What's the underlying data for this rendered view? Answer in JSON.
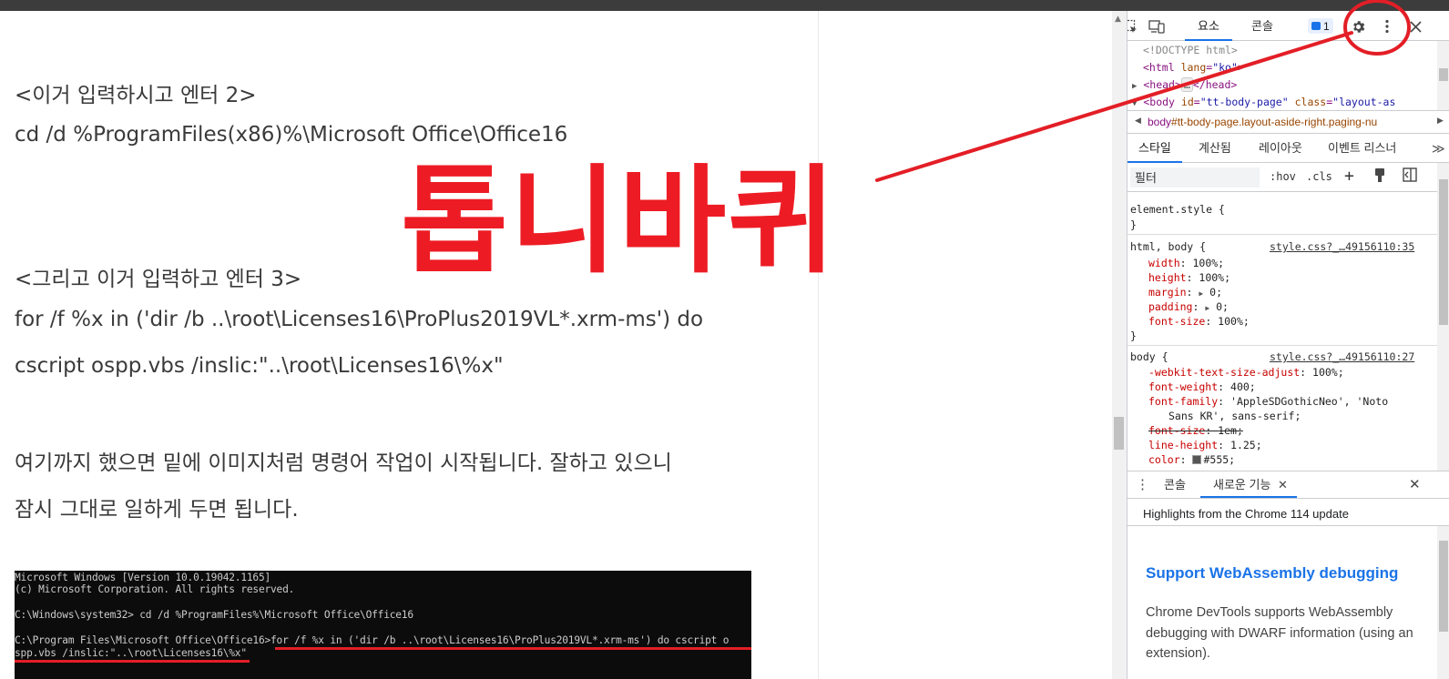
{
  "page": {
    "heading2": "<이거 입력하시고 엔터 2>",
    "cmd2": "cd /d %ProgramFiles(x86)%\\Microsoft Office\\Office16",
    "heading3": "<그리고 이거 입력하고 엔터 3>",
    "cmd3_line1": "for /f %x in ('dir /b ..\\root\\Licenses16\\ProPlus2019VL*.xrm-ms') do",
    "cmd3_line2": "cscript ospp.vbs /inslic:\"..\\root\\Licenses16\\%x\"",
    "info_line1": "여기까지 했으면 밑에 이미지처럼 명령어 작업이 시작됩니다. 잘하고 있으니",
    "info_line2": "잠시 그대로 일하게 두면 됩니다.",
    "overlay_title": "톱니바퀴",
    "terminal": {
      "line1": "Microsoft Windows [Version 10.0.19042.1165]",
      "line2": "(c) Microsoft Corporation. All rights reserved.",
      "line3": "C:\\Windows\\system32> cd /d %ProgramFiles%\\Microsoft Office\\Office16",
      "line4": "C:\\Program Files\\Microsoft Office\\Office16>for /f %x in ('dir /b ..\\root\\Licenses16\\ProPlus2019VL*.xrm-ms') do cscript o",
      "line5": "spp.vbs /inslic:\"..\\root\\Licenses16\\%x\""
    }
  },
  "devtools": {
    "toolbar": {
      "tab_elements": "요소",
      "tab_console": "콘솔",
      "message_count": "1",
      "icons": [
        "inspect-icon",
        "device-toolbar-icon",
        "gear-icon",
        "more-icon",
        "close-icon"
      ]
    },
    "dom": {
      "doctype": "<!DOCTYPE html>",
      "html_open": "<html",
      "html_attr": "lang",
      "html_val": "\"ko\"",
      "html_close": ">",
      "head_open": "<head>",
      "head_ellipsis": "…",
      "head_close": "</head>",
      "body_open": "<body",
      "body_id_attr": "id",
      "body_id_val": "\"tt-body-page\"",
      "body_class_attr": "class",
      "body_class_val": "\"layout-as"
    },
    "breadcrumb": {
      "tag": "body",
      "rest": "#tt-body-page.layout-aside-right.paging-nu"
    },
    "sub_tabs": {
      "styles": "스타일",
      "computed": "계산됨",
      "layout": "레이아웃",
      "event_listeners": "이벤트 리스너"
    },
    "filter": {
      "placeholder": "필터",
      "hov": ":hov",
      "cls": ".cls"
    },
    "styles": {
      "element_style": "element.style {",
      "close_brace": "}",
      "rule1_selector": "html, body {",
      "rule1_source": "style.css?_…49156110:35",
      "rule1_props": [
        {
          "name": "width",
          "value": "100%;"
        },
        {
          "name": "height",
          "value": "100%;"
        },
        {
          "name": "margin",
          "value": "0;"
        },
        {
          "name": "padding",
          "value": "0;"
        },
        {
          "name": "font-size",
          "value": "100%;"
        }
      ],
      "rule2_selector": "body {",
      "rule2_source": "style.css?_…49156110:27",
      "rule2_props": [
        {
          "name": "-webkit-text-size-adjust",
          "value": "100%;"
        },
        {
          "name": "font-weight",
          "value": "400;"
        },
        {
          "name": "font-family",
          "value": "'AppleSDGothicNeo', 'Noto"
        },
        {
          "name": "",
          "value": "Sans KR', sans-serif;"
        },
        {
          "name": "font-size",
          "value": "1em;"
        },
        {
          "name": "line-height",
          "value": "1.25;"
        },
        {
          "name": "color",
          "value": "#555;"
        }
      ]
    },
    "drawer": {
      "tab_console": "콘솔",
      "tab_whats_new": "새로운 기능",
      "header": "Highlights from the Chrome 114 update",
      "title": "Support WebAssembly debugging",
      "description": "Chrome DevTools supports WebAssembly debugging with DWARF information (using an extension)."
    }
  },
  "colors": {
    "annotation_red": "#ed1c24",
    "accent_blue": "#1a73e8",
    "terminal_bg": "#0c0c0c"
  }
}
